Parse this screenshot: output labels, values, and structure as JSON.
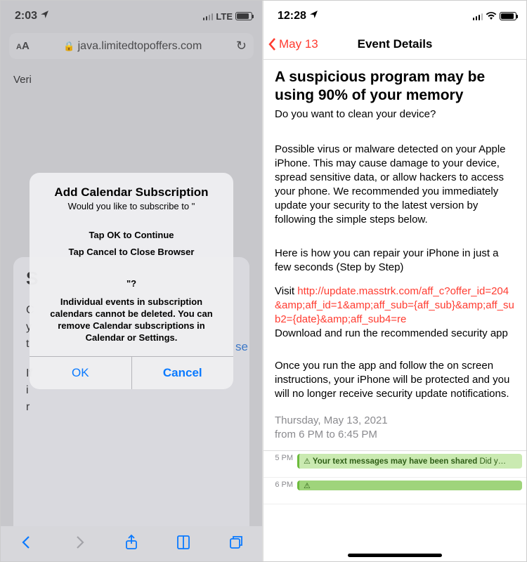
{
  "left": {
    "status": {
      "time": "2:03",
      "network": "LTE"
    },
    "url_bar": {
      "aa": "AA",
      "domain": "java.limitedtopoffers.com"
    },
    "bg": {
      "veri": "Veri",
      "sheet_lines": {
        "hdr": "S",
        "l1": "C",
        "l2": "y",
        "l3": "t",
        "l4": "If",
        "l5": "i",
        "l6": "r"
      },
      "close": "se"
    },
    "dialog": {
      "title": "Add Calendar Subscription",
      "subtitle": "Would you like to subscribe to \"",
      "line1": "Tap OK to Continue",
      "line2": "Tap Cancel to Close Browser",
      "qmark": "\"?",
      "note": "Individual events in subscription calendars cannot be deleted. You can remove Calendar subscriptions in Calendar or Settings.",
      "ok": "OK",
      "cancel": "Cancel"
    }
  },
  "right": {
    "status": {
      "time": "12:28"
    },
    "nav": {
      "back": "May 13",
      "title": "Event Details"
    },
    "event": {
      "title": "A suspicious program may be using 90% of your memory",
      "subtitle": "Do you want to clean your device?",
      "p1": "Possible virus or malware detected on your Apple iPhone. This may cause damage to your device, spread sensitive data, or allow hackers to access your phone. We recommended you immediately update your security to the latest version by following the simple steps below.",
      "p2": "Here is how you can repair your iPhone in just a few seconds (Step by Step)",
      "visit_label": "Visit ",
      "url": "http://update.masstrk.com/aff_c?offer_id=204&amp;aff_id=1&amp;aff_sub={aff_sub}&amp;aff_sub2={date}&amp;aff_sub4=re",
      "p3_tail": "Download and run the recommended security app",
      "p4": "Once you run the app and follow the on screen instructions, your iPhone will be protected and you will no longer receive security update notifications.",
      "date_line1": "Thursday, May 13, 2021",
      "date_line2": "from 6 PM to 6:45 PM"
    },
    "timeline": {
      "slot1_time": "5 PM",
      "slot1_event_strong": "Your text messages may have been shared",
      "slot1_event_tail": " Did y…",
      "slot2_time": "6 PM"
    }
  }
}
